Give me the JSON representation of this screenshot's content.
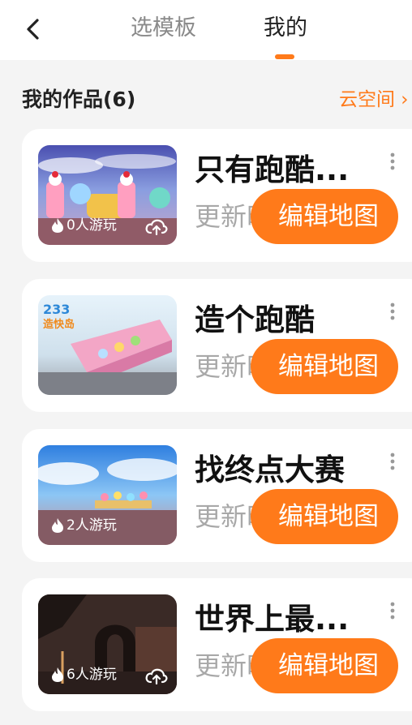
{
  "header": {
    "tabs": [
      "选模板",
      "我的"
    ],
    "active_tab": "我的"
  },
  "section": {
    "title": "我的作品(6)",
    "cloud_link": "云空间 ›"
  },
  "colors": {
    "accent": "#ff7a1a"
  },
  "works": [
    {
      "title": "只有跑酷...",
      "plays": "0人游玩",
      "show_plays": true,
      "update_text": "更新时间 8",
      "edit_label": "编辑地图",
      "theme": "candy"
    },
    {
      "title": "造个跑酷",
      "plays": "",
      "show_plays": false,
      "update_text": "更新时间 8",
      "edit_label": "编辑地图",
      "theme": "pink"
    },
    {
      "title": "找终点大赛",
      "plays": "2人游玩",
      "show_plays": true,
      "update_text": "更新时间 8",
      "edit_label": "编辑地图",
      "theme": "sky"
    },
    {
      "title": "世界上最...",
      "plays": "6人游玩",
      "show_plays": true,
      "update_text": "更新时间 8",
      "edit_label": "编辑地图",
      "theme": "dark"
    }
  ]
}
